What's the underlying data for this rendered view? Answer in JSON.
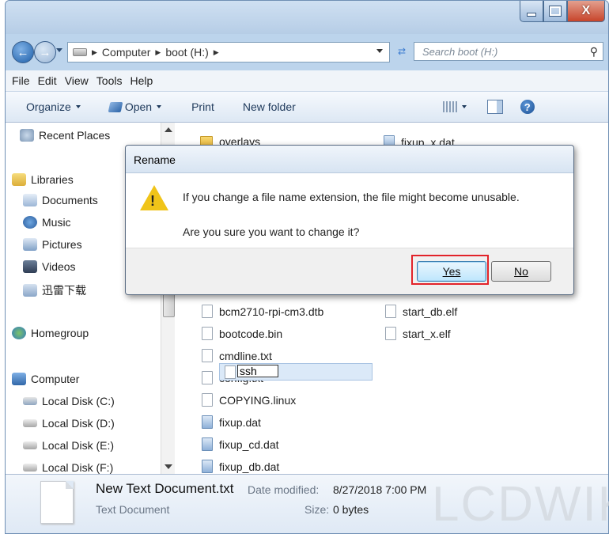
{
  "window": {
    "caption_buttons": {
      "minimize": "_",
      "maximize": "□",
      "close": "X"
    }
  },
  "address": {
    "crumbs": [
      "Computer",
      "boot (H:)"
    ],
    "search_placeholder": "Search boot (H:)"
  },
  "menu": [
    "File",
    "Edit",
    "View",
    "Tools",
    "Help"
  ],
  "toolbar": {
    "organize": "Organize",
    "open": "Open",
    "print": "Print",
    "new_folder": "New folder"
  },
  "nav": {
    "recent": "Recent Places",
    "libraries": "Libraries",
    "documents": "Documents",
    "music": "Music",
    "pictures": "Pictures",
    "videos": "Videos",
    "thunder": "迅雷下载",
    "homegroup": "Homegroup",
    "computer": "Computer",
    "disk_c": "Local Disk (C:)",
    "disk_d": "Local Disk (D:)",
    "disk_e": "Local Disk (E:)",
    "disk_f": "Local Disk (F:)"
  },
  "files_col1": [
    "overlays",
    "bcm2710-rpi-cm3.dtb",
    "bootcode.bin",
    "cmdline.txt",
    "config.txt",
    "COPYING.linux",
    "fixup.dat",
    "fixup_cd.dat",
    "fixup_db.dat"
  ],
  "files_col2": [
    "fixup_x.dat",
    "start_db.elf",
    "start_x.elf"
  ],
  "rename_value": "ssh",
  "details": {
    "name": "New Text Document.txt",
    "modified_label": "Date modified:",
    "modified": "8/27/2018 7:00 PM",
    "type": "Text Document",
    "size_label": "Size:",
    "size": "0 bytes"
  },
  "watermark": "LCDWIK",
  "dialog": {
    "title": "Rename",
    "message": "If you change a file name extension, the file might become unusable.",
    "question": "Are you sure you want to change it?",
    "yes": "Yes",
    "no": "No"
  },
  "colors": {
    "accent": "#e2232a",
    "warning": "#f0c419",
    "selection": "#dbe9f8"
  }
}
